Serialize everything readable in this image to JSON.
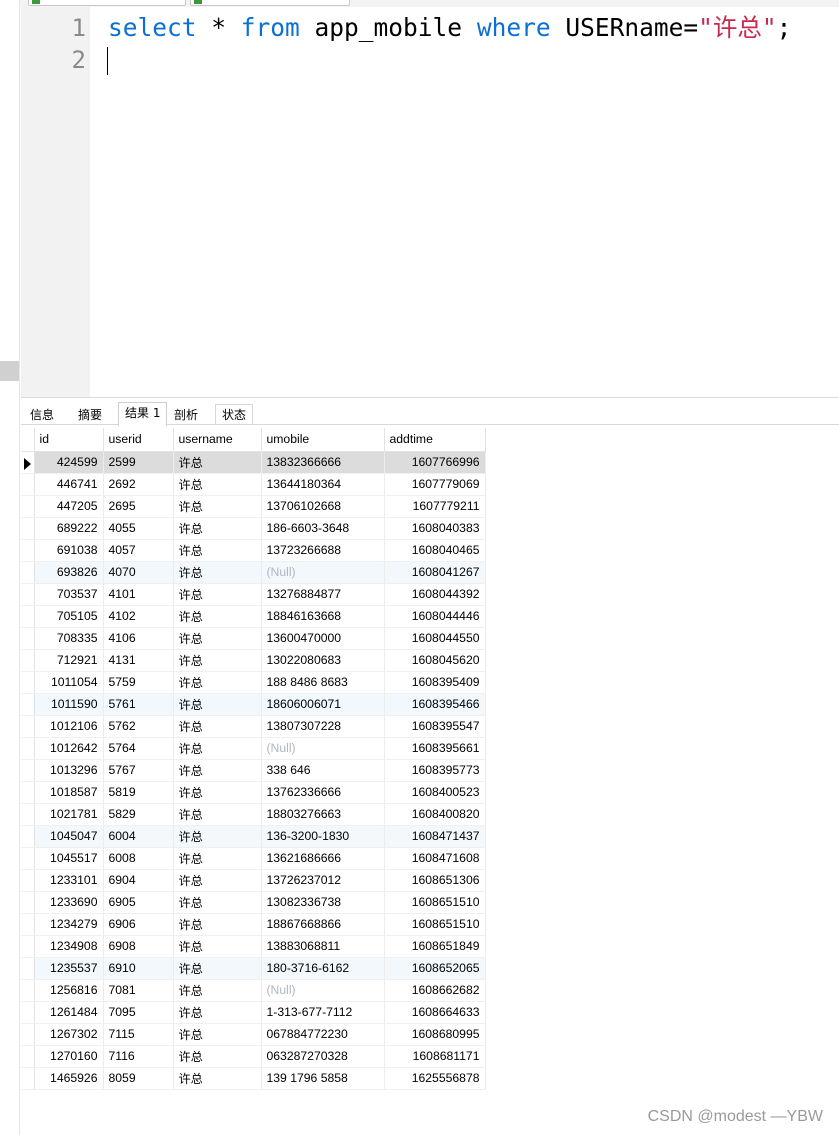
{
  "editor": {
    "line_numbers": [
      "1",
      "2"
    ],
    "tokens": {
      "select": "select",
      "star": " * ",
      "from": "from",
      "table": " app_mobile ",
      "where": "where",
      "field": " USERname=",
      "value": "\"许总\"",
      "end": ";"
    }
  },
  "results": {
    "tabs": [
      "信息",
      "摘要",
      "结果 1",
      "剖析",
      "状态"
    ],
    "active_tab": "结果 1",
    "columns": [
      "id",
      "userid",
      "username",
      "umobile",
      "addtime"
    ],
    "rows": [
      [
        "424599",
        "2599",
        "许总",
        "13832366666",
        "1607766996"
      ],
      [
        "446741",
        "2692",
        "许总",
        "13644180364",
        "1607779069"
      ],
      [
        "447205",
        "2695",
        "许总",
        "13706102668",
        "1607779211"
      ],
      [
        "689222",
        "4055",
        "许总",
        "186-6603-3648",
        "1608040383"
      ],
      [
        "691038",
        "4057",
        "许总",
        "13723266688",
        "1608040465"
      ],
      [
        "693826",
        "4070",
        "许总",
        "(Null)",
        "1608041267"
      ],
      [
        "703537",
        "4101",
        "许总",
        "13276884877",
        "1608044392"
      ],
      [
        "705105",
        "4102",
        "许总",
        "18846163668",
        "1608044446"
      ],
      [
        "708335",
        "4106",
        "许总",
        "13600470000",
        "1608044550"
      ],
      [
        "712921",
        "4131",
        "许总",
        "13022080683",
        "1608045620"
      ],
      [
        "1011054",
        "5759",
        "许总",
        "188 8486 8683",
        "1608395409"
      ],
      [
        "1011590",
        "5761",
        "许总",
        "18606006071",
        "1608395466"
      ],
      [
        "1012106",
        "5762",
        "许总",
        "13807307228",
        "1608395547"
      ],
      [
        "1012642",
        "5764",
        "许总",
        "(Null)",
        "1608395661"
      ],
      [
        "1013296",
        "5767",
        "许总",
        "338 646",
        "1608395773"
      ],
      [
        "1018587",
        "5819",
        "许总",
        "13762336666",
        "1608400523"
      ],
      [
        "1021781",
        "5829",
        "许总",
        "18803276663",
        "1608400820"
      ],
      [
        "1045047",
        "6004",
        "许总",
        "136-3200-1830",
        "1608471437"
      ],
      [
        "1045517",
        "6008",
        "许总",
        "13621686666",
        "1608471608"
      ],
      [
        "1233101",
        "6904",
        "许总",
        "13726237012",
        "1608651306"
      ],
      [
        "1233690",
        "6905",
        "许总",
        "13082336738",
        "1608651510"
      ],
      [
        "1234279",
        "6906",
        "许总",
        "18867668866",
        "1608651510"
      ],
      [
        "1234908",
        "6908",
        "许总",
        "13883068811",
        "1608651849"
      ],
      [
        "1235537",
        "6910",
        "许总",
        "180-3716-6162",
        "1608652065"
      ],
      [
        "1256816",
        "7081",
        "许总",
        "(Null)",
        "1608662682"
      ],
      [
        "1261484",
        "7095",
        "许总",
        "1-313-677-7112",
        "1608664633"
      ],
      [
        "1267302",
        "7115",
        "许总",
        "067884772230",
        "1608680995"
      ],
      [
        "1270160",
        "7116",
        "许总",
        "063287270328",
        "1608681171"
      ],
      [
        "1465926",
        "8059",
        "许总",
        "139 1796 5858",
        "1625556878"
      ]
    ],
    "selected_row": 0,
    "highlighted_rows": [
      5,
      11,
      17,
      23
    ]
  },
  "watermark": "CSDN @modest —YBW"
}
